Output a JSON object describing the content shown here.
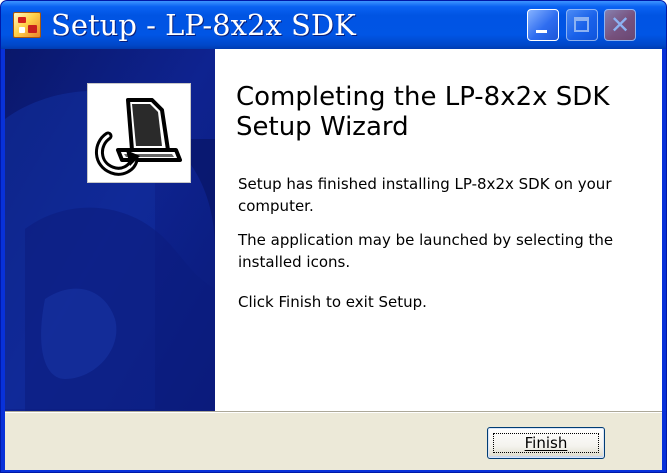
{
  "window": {
    "title": "Setup - LP-8x2x SDK",
    "titlebar_color": "#0054e3",
    "icons": {
      "app": "installer-app-icon",
      "minimize": "minimize-icon",
      "maximize": "maximize-icon",
      "close": "close-icon",
      "side_logo": "computer-install-icon"
    }
  },
  "wizard": {
    "heading": "Completing the LP-8x2x SDK Setup Wizard",
    "paragraphs": [
      "Setup has finished installing LP-8x2x SDK on your computer.",
      "The application may be launched by selecting the installed icons.",
      "Click Finish to exit Setup."
    ],
    "side_panel_color": "#0c1d7c"
  },
  "buttons": {
    "finish_label": "Finish"
  }
}
